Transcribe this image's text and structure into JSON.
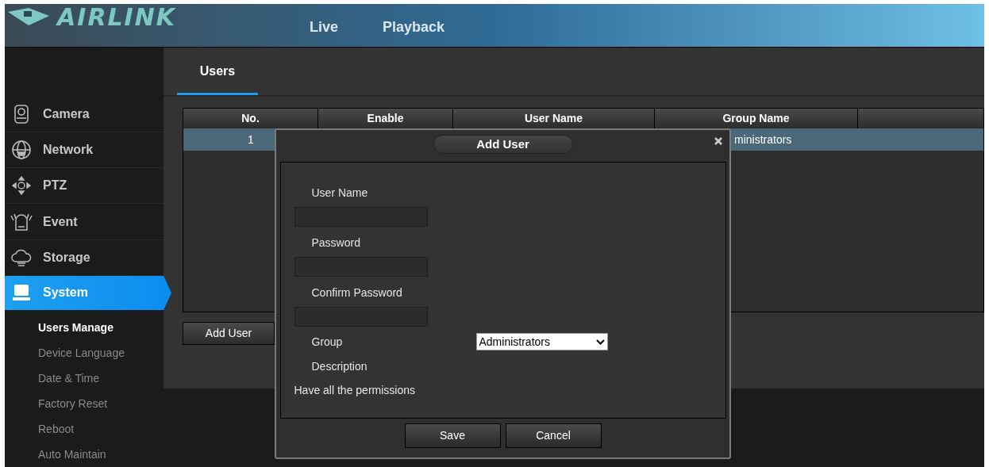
{
  "header": {
    "logo": "AIRLINK",
    "nav": [
      {
        "label": "Live"
      },
      {
        "label": "Playback"
      }
    ]
  },
  "sidebar": {
    "items": [
      {
        "label": "Camera",
        "kind": "camera",
        "selected": false
      },
      {
        "label": "Network",
        "kind": "network",
        "selected": false
      },
      {
        "label": "PTZ",
        "kind": "ptz",
        "selected": false
      },
      {
        "label": "Event",
        "kind": "event",
        "selected": false
      },
      {
        "label": "Storage",
        "kind": "storage",
        "selected": false
      },
      {
        "label": "System",
        "kind": "system",
        "selected": true,
        "children": [
          {
            "label": "Users Manage",
            "selected": true
          },
          {
            "label": "Device Language",
            "selected": false
          },
          {
            "label": "Date & Time",
            "selected": false
          },
          {
            "label": "Factory Reset",
            "selected": false
          },
          {
            "label": "Reboot",
            "selected": false
          },
          {
            "label": "Auto Maintain",
            "selected": false
          }
        ]
      }
    ]
  },
  "tabs": [
    {
      "label": "Users",
      "selected": true
    }
  ],
  "table": {
    "columns": [
      "No.",
      "Enable",
      "User Name",
      "Group Name"
    ],
    "rows": [
      {
        "no": "1",
        "group_name": "ministrators",
        "selected": true
      }
    ]
  },
  "add_user_button": "Add User",
  "dialog": {
    "title": "Add User",
    "fields": [
      {
        "label": "User Name",
        "kind": "input"
      },
      {
        "label": "Password",
        "kind": "input"
      },
      {
        "label": "Confirm Password",
        "kind": "input"
      },
      {
        "label": "Group",
        "kind": "select",
        "value": "Administrators"
      },
      {
        "label": "Description",
        "kind": "text"
      }
    ],
    "description": "Have all the permissions",
    "buttons": [
      "Save",
      "Cancel"
    ]
  }
}
